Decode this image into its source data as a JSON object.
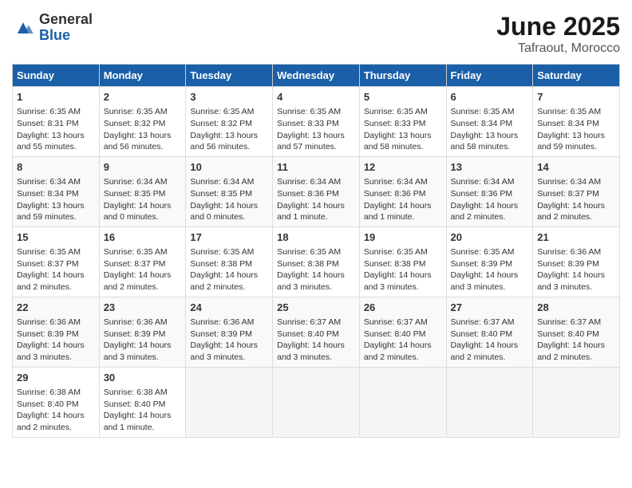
{
  "header": {
    "logo_general": "General",
    "logo_blue": "Blue",
    "month": "June 2025",
    "location": "Tafraout, Morocco"
  },
  "days_of_week": [
    "Sunday",
    "Monday",
    "Tuesday",
    "Wednesday",
    "Thursday",
    "Friday",
    "Saturday"
  ],
  "weeks": [
    [
      {
        "day": "1",
        "info": "Sunrise: 6:35 AM\nSunset: 8:31 PM\nDaylight: 13 hours and 55 minutes."
      },
      {
        "day": "2",
        "info": "Sunrise: 6:35 AM\nSunset: 8:32 PM\nDaylight: 13 hours and 56 minutes."
      },
      {
        "day": "3",
        "info": "Sunrise: 6:35 AM\nSunset: 8:32 PM\nDaylight: 13 hours and 56 minutes."
      },
      {
        "day": "4",
        "info": "Sunrise: 6:35 AM\nSunset: 8:33 PM\nDaylight: 13 hours and 57 minutes."
      },
      {
        "day": "5",
        "info": "Sunrise: 6:35 AM\nSunset: 8:33 PM\nDaylight: 13 hours and 58 minutes."
      },
      {
        "day": "6",
        "info": "Sunrise: 6:35 AM\nSunset: 8:34 PM\nDaylight: 13 hours and 58 minutes."
      },
      {
        "day": "7",
        "info": "Sunrise: 6:35 AM\nSunset: 8:34 PM\nDaylight: 13 hours and 59 minutes."
      }
    ],
    [
      {
        "day": "8",
        "info": "Sunrise: 6:34 AM\nSunset: 8:34 PM\nDaylight: 13 hours and 59 minutes."
      },
      {
        "day": "9",
        "info": "Sunrise: 6:34 AM\nSunset: 8:35 PM\nDaylight: 14 hours and 0 minutes."
      },
      {
        "day": "10",
        "info": "Sunrise: 6:34 AM\nSunset: 8:35 PM\nDaylight: 14 hours and 0 minutes."
      },
      {
        "day": "11",
        "info": "Sunrise: 6:34 AM\nSunset: 8:36 PM\nDaylight: 14 hours and 1 minute."
      },
      {
        "day": "12",
        "info": "Sunrise: 6:34 AM\nSunset: 8:36 PM\nDaylight: 14 hours and 1 minute."
      },
      {
        "day": "13",
        "info": "Sunrise: 6:34 AM\nSunset: 8:36 PM\nDaylight: 14 hours and 2 minutes."
      },
      {
        "day": "14",
        "info": "Sunrise: 6:34 AM\nSunset: 8:37 PM\nDaylight: 14 hours and 2 minutes."
      }
    ],
    [
      {
        "day": "15",
        "info": "Sunrise: 6:35 AM\nSunset: 8:37 PM\nDaylight: 14 hours and 2 minutes."
      },
      {
        "day": "16",
        "info": "Sunrise: 6:35 AM\nSunset: 8:37 PM\nDaylight: 14 hours and 2 minutes."
      },
      {
        "day": "17",
        "info": "Sunrise: 6:35 AM\nSunset: 8:38 PM\nDaylight: 14 hours and 2 minutes."
      },
      {
        "day": "18",
        "info": "Sunrise: 6:35 AM\nSunset: 8:38 PM\nDaylight: 14 hours and 3 minutes."
      },
      {
        "day": "19",
        "info": "Sunrise: 6:35 AM\nSunset: 8:38 PM\nDaylight: 14 hours and 3 minutes."
      },
      {
        "day": "20",
        "info": "Sunrise: 6:35 AM\nSunset: 8:39 PM\nDaylight: 14 hours and 3 minutes."
      },
      {
        "day": "21",
        "info": "Sunrise: 6:36 AM\nSunset: 8:39 PM\nDaylight: 14 hours and 3 minutes."
      }
    ],
    [
      {
        "day": "22",
        "info": "Sunrise: 6:36 AM\nSunset: 8:39 PM\nDaylight: 14 hours and 3 minutes."
      },
      {
        "day": "23",
        "info": "Sunrise: 6:36 AM\nSunset: 8:39 PM\nDaylight: 14 hours and 3 minutes."
      },
      {
        "day": "24",
        "info": "Sunrise: 6:36 AM\nSunset: 8:39 PM\nDaylight: 14 hours and 3 minutes."
      },
      {
        "day": "25",
        "info": "Sunrise: 6:37 AM\nSunset: 8:40 PM\nDaylight: 14 hours and 3 minutes."
      },
      {
        "day": "26",
        "info": "Sunrise: 6:37 AM\nSunset: 8:40 PM\nDaylight: 14 hours and 2 minutes."
      },
      {
        "day": "27",
        "info": "Sunrise: 6:37 AM\nSunset: 8:40 PM\nDaylight: 14 hours and 2 minutes."
      },
      {
        "day": "28",
        "info": "Sunrise: 6:37 AM\nSunset: 8:40 PM\nDaylight: 14 hours and 2 minutes."
      }
    ],
    [
      {
        "day": "29",
        "info": "Sunrise: 6:38 AM\nSunset: 8:40 PM\nDaylight: 14 hours and 2 minutes."
      },
      {
        "day": "30",
        "info": "Sunrise: 6:38 AM\nSunset: 8:40 PM\nDaylight: 14 hours and 1 minute."
      },
      {
        "day": "",
        "info": ""
      },
      {
        "day": "",
        "info": ""
      },
      {
        "day": "",
        "info": ""
      },
      {
        "day": "",
        "info": ""
      },
      {
        "day": "",
        "info": ""
      }
    ]
  ]
}
